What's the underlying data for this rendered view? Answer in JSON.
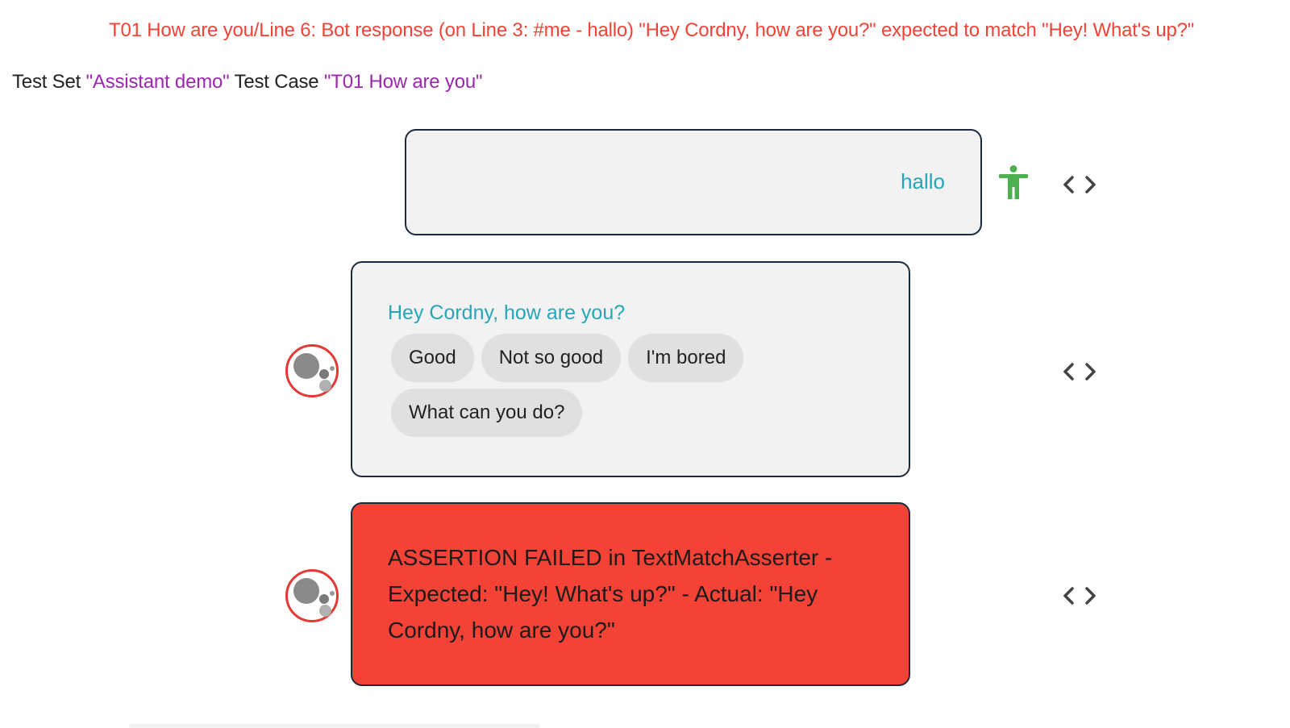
{
  "error_banner": "T01 How are you/Line 6: Bot response (on Line 3: #me - hallo) \"Hey Cordny, how are you?\" expected to match \"Hey! What's up?\"",
  "header": {
    "set_label": "Test Set ",
    "set_name": "\"Assistant demo\"",
    "case_label": " Test Case ",
    "case_name": "\"T01 How are you\""
  },
  "conversation": {
    "me_message": "hallo",
    "bot_message": "Hey Cordny, how are you?",
    "suggestions": [
      "Good",
      "Not so good",
      "I'm bored",
      "What can you do?"
    ],
    "assertion_error": "ASSERTION FAILED in TextMatchAsserter - Expected: \"Hey! What's up?\"  - Actual: \"Hey Cordny, how are you?\""
  },
  "icons": {
    "me_avatar": "accessibility-person-icon",
    "bot_avatar": "assistant-bot-icon",
    "source_toggle": "code-brackets-icon"
  },
  "colors": {
    "error": "#f44336",
    "highlight": "#9c27b0",
    "message_text": "#26a6b8",
    "person_icon": "#4caf50"
  }
}
